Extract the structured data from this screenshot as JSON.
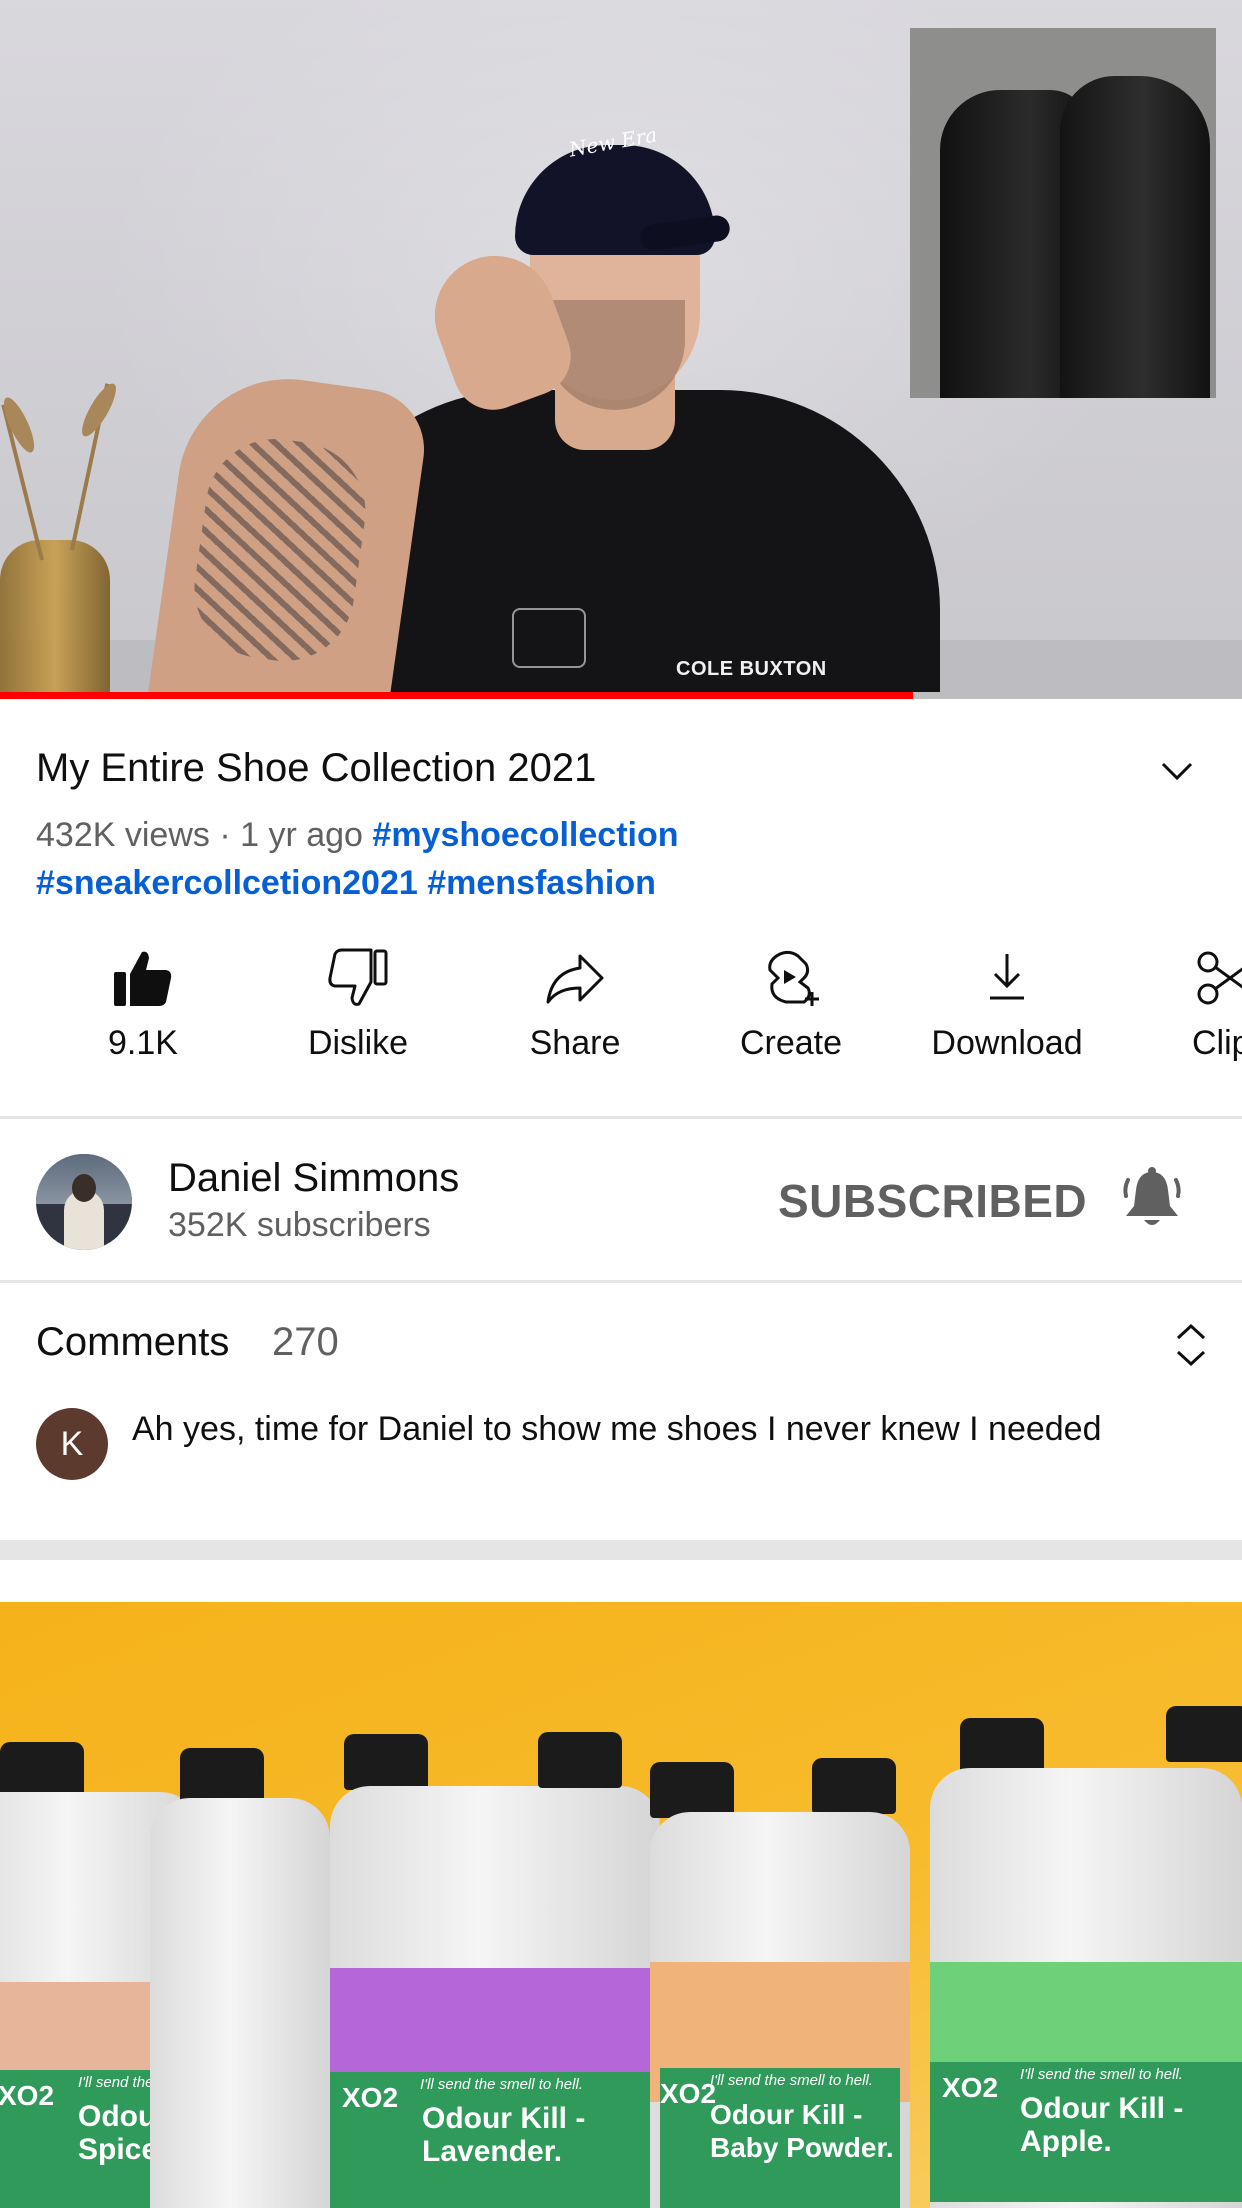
{
  "video": {
    "progress_fraction": 0.735,
    "overlay_text": {
      "cap_logo": "New Era",
      "shirt_print": "COLE BUXTON"
    }
  },
  "title": "My Entire Shoe Collection 2021",
  "meta": {
    "views": "432K views",
    "separator": " · ",
    "age": "1 yr ago",
    "hashtags_line1": [
      "#myshoecollection"
    ],
    "hashtags_line2": [
      "#sneakercollcetion2021",
      "#mensfashion"
    ]
  },
  "actions": [
    {
      "icon": "thumbs-up-icon",
      "label": "9.1K"
    },
    {
      "icon": "thumbs-down-icon",
      "label": "Dislike"
    },
    {
      "icon": "share-icon",
      "label": "Share"
    },
    {
      "icon": "create-icon",
      "label": "Create"
    },
    {
      "icon": "download-icon",
      "label": "Download"
    },
    {
      "icon": "clip-icon",
      "label": "Clip"
    }
  ],
  "channel": {
    "name": "Daniel Simmons",
    "subscribers": "352K subscribers",
    "subscribe_state": "SUBSCRIBED",
    "bell_icon": "bell-icon"
  },
  "comments": {
    "title": "Comments",
    "count": "270",
    "top_comment": {
      "avatar_letter": "K",
      "text": "Ah yes, time for Daniel to show me shoes I never knew I needed"
    }
  },
  "ad": {
    "bottles": [
      {
        "brand": "XO2",
        "tagline": "I'll send the smell to hell.",
        "name": "Odour Kill - Spice."
      },
      {
        "brand": "XO2",
        "tagline": "I'll send the smell to hell.",
        "name": "Odour Kill - Lavender."
      },
      {
        "brand": "XO2",
        "tagline": "I'll send the smell to hell.",
        "name": "Odour Kill - Baby Powder."
      },
      {
        "brand": "XO2",
        "tagline": "I'll send the smell to hell.",
        "name": "Odour Kill - Apple."
      }
    ]
  },
  "colors": {
    "accent_red": "#ff0000",
    "hashtag_blue": "#065fd4",
    "secondary_text": "#606060",
    "ad_background": "#f6b21a"
  }
}
